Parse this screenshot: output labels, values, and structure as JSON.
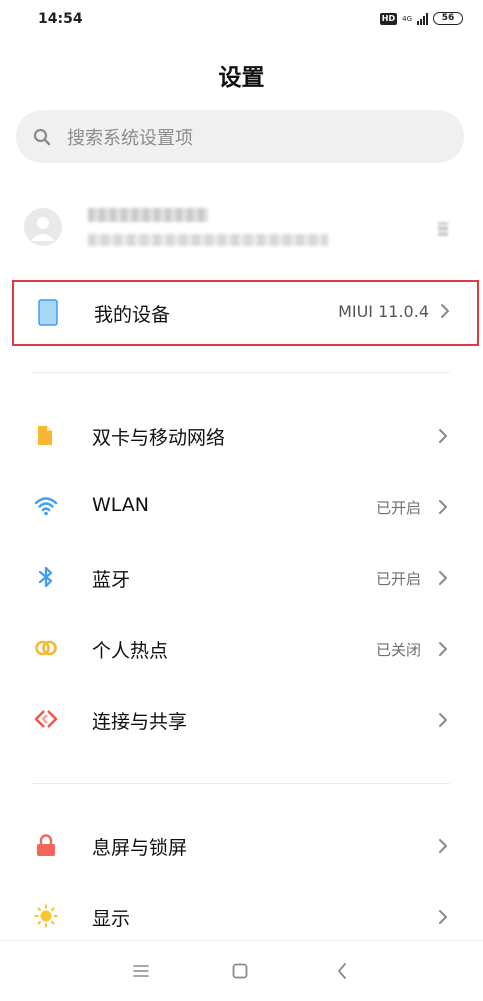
{
  "status_bar": {
    "time": "14:54",
    "hd": "HD",
    "network": "4G",
    "battery": "56"
  },
  "header": {
    "title": "设置"
  },
  "search": {
    "placeholder": "搜索系统设置项"
  },
  "device": {
    "label": "我的设备",
    "value": "MIUI 11.0.4"
  },
  "network_section": [
    {
      "label": "双卡与移动网络",
      "value": "",
      "icon": "sim-card-icon"
    },
    {
      "label": "WLAN",
      "value": "已开启",
      "icon": "wifi-icon"
    },
    {
      "label": "蓝牙",
      "value": "已开启",
      "icon": "bluetooth-icon"
    },
    {
      "label": "个人热点",
      "value": "已关闭",
      "icon": "hotspot-icon"
    },
    {
      "label": "连接与共享",
      "value": "",
      "icon": "connection-share-icon"
    }
  ],
  "display_section": [
    {
      "label": "息屏与锁屏",
      "value": "",
      "icon": "lock-icon"
    },
    {
      "label": "显示",
      "value": "",
      "icon": "brightness-icon"
    }
  ],
  "colors": {
    "highlight_border": "#e0393e",
    "sim_icon": "#f7b731",
    "wifi_icon": "#3d9df3",
    "bluetooth_icon": "#3d9df3",
    "hotspot_icon": "#f7b731",
    "connection_icon": "#ee5a4a",
    "lock_icon": "#f4655a",
    "brightness_icon": "#f7c631",
    "device_icon": "#a9d8f5"
  },
  "nav": {
    "icons": [
      "menu-icon",
      "home-icon",
      "back-icon"
    ]
  }
}
